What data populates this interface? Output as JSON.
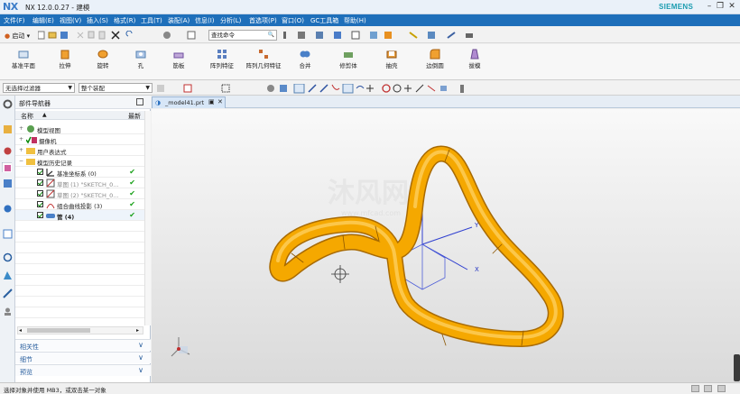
{
  "window": {
    "logo": "NX",
    "title": "NX 12.0.0.27 - 建模",
    "brand": "SIEMENS",
    "brand_color": "#1b9cb0"
  },
  "menubar": {
    "color": "#1e6fba",
    "items": [
      "文件(F)",
      "编辑(E)",
      "视图(V)",
      "插入(S)",
      "格式(R)",
      "工具(T)",
      "装配(A)",
      "信息(I)",
      "分析(L)",
      "首选项(P)",
      "窗口(O)",
      "GC工具箱",
      "帮助(H)"
    ]
  },
  "toolbar1": {
    "start_label": "启动",
    "search_placeholder": "查找命令"
  },
  "ribbon": {
    "buttons": [
      "基准平面",
      "拉伸",
      "旋转",
      "孔",
      "筋板",
      "阵列特征",
      "阵列几何特征",
      "合并",
      "修剪体",
      "抽壳",
      "边倒圆",
      "拔模"
    ]
  },
  "toolbar2": {
    "filter": "无选择过滤器",
    "scope": "整个装配"
  },
  "navigator": {
    "title": "部件导航器",
    "col_name": "名称",
    "col_latest": "最新",
    "items": [
      {
        "label": "模型视图",
        "level": 0
      },
      {
        "label": "摄像机",
        "level": 0
      },
      {
        "label": "用户表达式",
        "level": 0
      },
      {
        "label": "模型历史记录",
        "level": 0
      },
      {
        "label": "基准坐标系 (0)",
        "level": 1,
        "latest": "✔"
      },
      {
        "label": "草图 (1) \"SKETCH_0...",
        "level": 1,
        "latest": "✔"
      },
      {
        "label": "草图 (2) \"SKETCH_0...",
        "level": 1,
        "latest": "✔"
      },
      {
        "label": "组合曲线投影 (3)",
        "level": 1,
        "latest": "✔"
      },
      {
        "label": "管 (4)",
        "level": 1,
        "latest": "✔"
      }
    ],
    "sections": [
      "相关性",
      "细节",
      "预览"
    ]
  },
  "tab": {
    "label": "_model41.prt"
  },
  "viewport": {
    "watermark": "沐风网",
    "watermark_url": "www.mfcad.com",
    "axis_y": "Y",
    "axis_x": "X",
    "axis_z": "Z",
    "tube_color": "#f5a800"
  },
  "status": {
    "text": "选择对象并使用 MB3，或双击某一对象"
  }
}
